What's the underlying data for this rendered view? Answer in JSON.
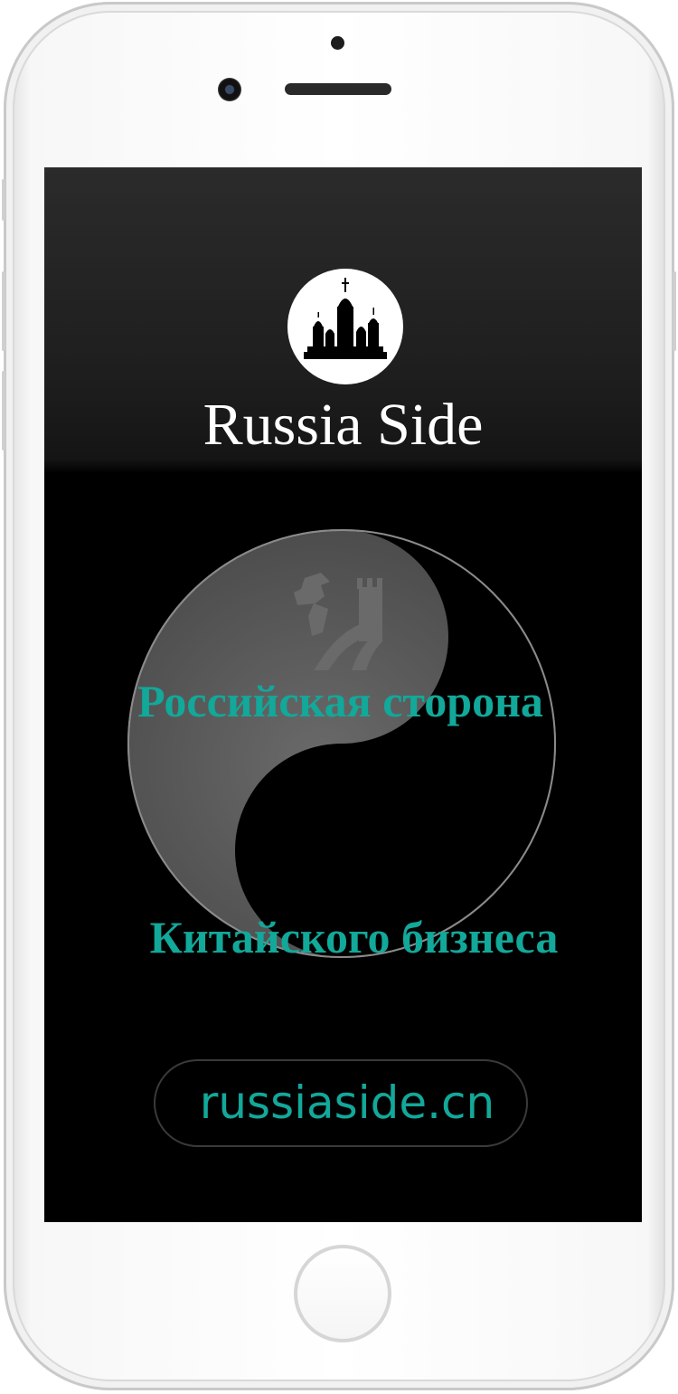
{
  "app": {
    "brand_name": "Russia Side"
  },
  "hero": {
    "headline_1": "Российская сторона",
    "headline_2": "Китайского бизнеса"
  },
  "footer": {
    "website": "russiaside.cn"
  },
  "icons": {
    "logo": "kremlin-logo-icon",
    "wall": "great-wall-icon",
    "cathedral": "cathedral-icon",
    "background": "yin-yang-icon"
  },
  "colors": {
    "accent": "#12a89a",
    "screen_background": "#000000",
    "brand_text": "#ffffff"
  }
}
